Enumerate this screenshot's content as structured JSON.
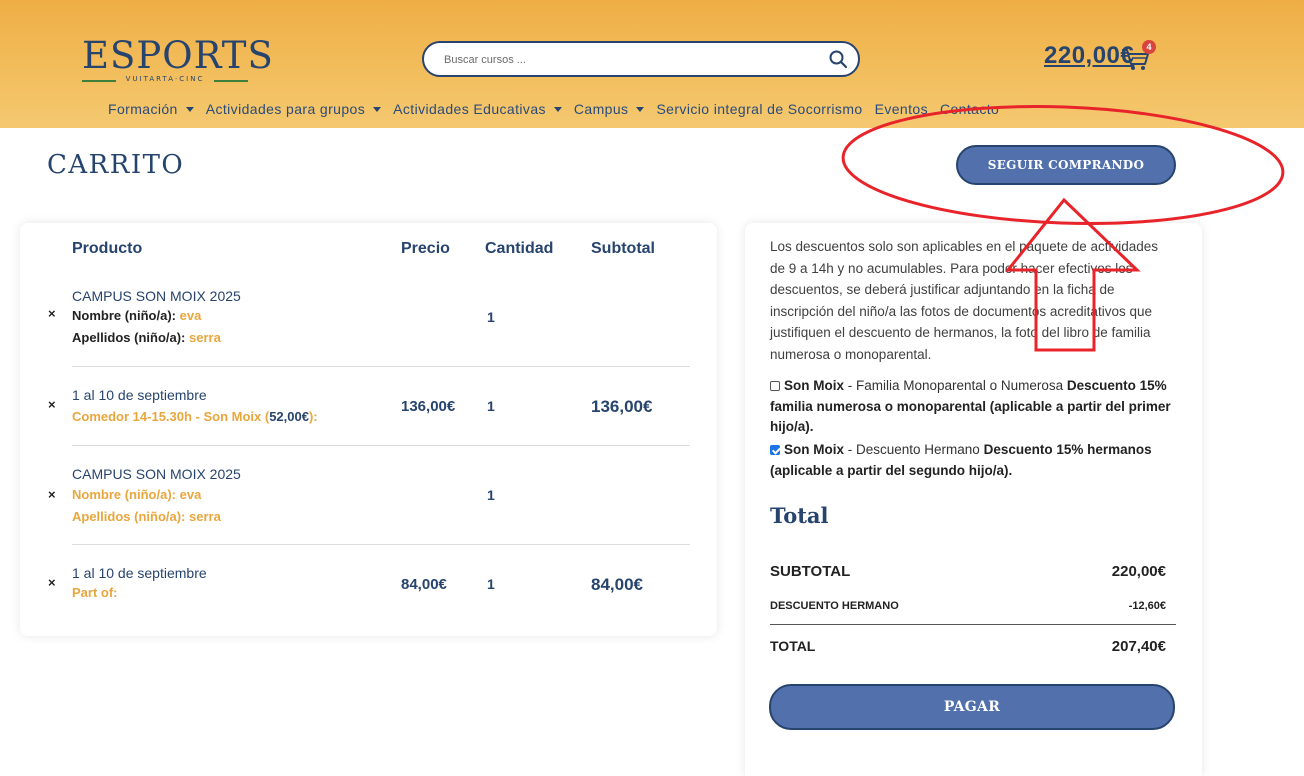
{
  "header": {
    "logo": {
      "name": "ESPORTS",
      "sub": "VUITARTA·CINC"
    },
    "search": {
      "placeholder": "Buscar cursos ..."
    },
    "cart": {
      "total": "220,00€",
      "badge": "4"
    },
    "nav": [
      {
        "label": "Formación",
        "dropdown": true
      },
      {
        "label": "Actividades para grupos",
        "dropdown": true
      },
      {
        "label": "Actividades Educativas",
        "dropdown": true
      },
      {
        "label": "Campus",
        "dropdown": true
      },
      {
        "label": "Servicio integral de Socorrismo",
        "dropdown": false
      },
      {
        "label": "Eventos",
        "dropdown": false
      },
      {
        "label": "Contacto",
        "dropdown": false
      }
    ]
  },
  "page": {
    "title": "CARRITO",
    "continue_label": "SEGUIR COMPRANDO"
  },
  "cart_table": {
    "headers": {
      "product": "Producto",
      "price": "Precio",
      "quantity": "Cantidad",
      "subtotal": "Subtotal"
    },
    "remove_symbol": "×",
    "rows": [
      {
        "name": "CAMPUS SON MOIX 2025",
        "meta": [
          {
            "label": "Nombre (niño/a):",
            "value": "eva"
          },
          {
            "label": "Apellidos (niño/a):",
            "value": "serra"
          }
        ],
        "price": "",
        "quantity": "1",
        "subtotal": ""
      },
      {
        "name": "1 al 10 de septiembre",
        "option": {
          "text": "Comedor 14-15.30h - Son Moix (",
          "amount": "52,00€",
          "suffix": "):"
        },
        "price": "136,00€",
        "quantity": "1",
        "subtotal": "136,00€"
      },
      {
        "name": "CAMPUS SON MOIX 2025",
        "meta": [
          {
            "label": "Nombre (niño/a):",
            "value": "eva"
          },
          {
            "label": "Apellidos (niño/a):",
            "value": "serra"
          }
        ],
        "price": "",
        "quantity": "1",
        "subtotal": ""
      },
      {
        "name": "1 al 10 de septiembre",
        "option_plain": "Part of:",
        "price": "84,00€",
        "quantity": "1",
        "subtotal": "84,00€"
      }
    ]
  },
  "summary": {
    "discount_notice": "Los descuentos solo son aplicables en el paquete de actividades de 9 a 14h y no acumulables. Para poder hacer efectivos los descuentos, se deberá justificar adjuntando en la ficha de inscripción del niño/a las fotos de documentos acreditativos que justifiquen el descuento de hermanos, la foto del libro de familia numerosa o monoparental.",
    "options": [
      {
        "checked": false,
        "place": "Son Moix",
        "sep": " - ",
        "desc": "Familia Monoparental o Numerosa ",
        "title": "Descuento 15% familia numerosa o monoparental (aplicable a partir del primer hijo/a)."
      },
      {
        "checked": true,
        "place": "Son Moix",
        "sep": " - ",
        "desc": "Descuento Hermano ",
        "title": "Descuento 15% hermanos (aplicable a partir del segundo hijo/a)."
      }
    ],
    "total_heading": "Total",
    "lines": [
      {
        "label": "SUBTOTAL",
        "value": "220,00€"
      },
      {
        "label": "DESCUENTO HERMANO",
        "value": "-12,60€"
      },
      {
        "label": "TOTAL",
        "value": "207,40€"
      }
    ],
    "pay_label": "PAGAR"
  },
  "colors": {
    "brand_navy": "#27446e",
    "header_orange": "#f2bd5c",
    "accent_orange": "#e9a63d",
    "button_blue": "#5170ac",
    "annotation_red": "#e8242a"
  }
}
